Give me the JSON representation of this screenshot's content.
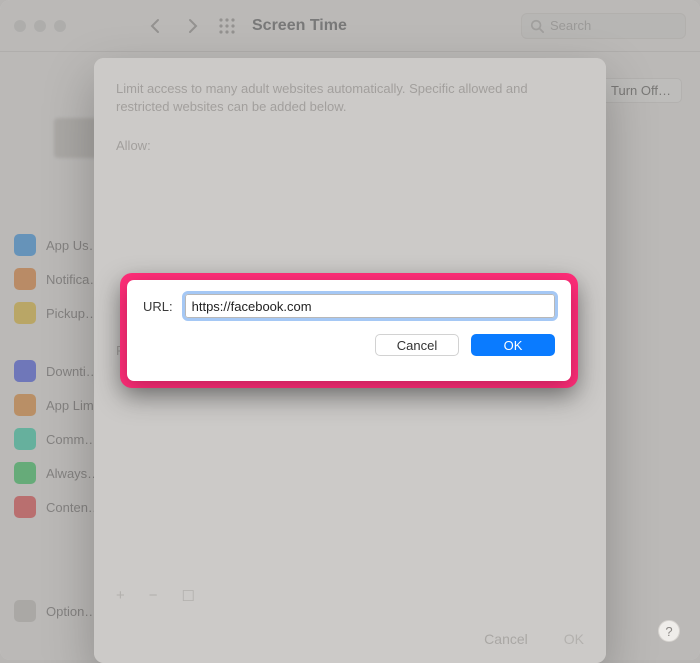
{
  "window": {
    "title": "Screen Time",
    "search_placeholder": "Search",
    "turn_off_label": "Turn Off…"
  },
  "sidebar": {
    "items": [
      {
        "label": "App Us…"
      },
      {
        "label": "Notifica…"
      },
      {
        "label": "Pickup…"
      },
      {
        "label": "Downti…"
      },
      {
        "label": "App Lim…"
      },
      {
        "label": "Comm…"
      },
      {
        "label": "Always…"
      },
      {
        "label": "Conten…"
      },
      {
        "label": "Option…"
      }
    ]
  },
  "content_sheet": {
    "description": "Limit access to many adult websites automatically. Specific allowed and restricted websites can be added below.",
    "allow_label": "Allow:",
    "restrict_initial": "R",
    "add_symbol": "+",
    "remove_symbol": "−",
    "edit_symbol": "☐",
    "cancel_label": "Cancel",
    "ok_label": "OK"
  },
  "url_sheet": {
    "url_label": "URL:",
    "url_value": "https://facebook.com",
    "cancel_label": "Cancel",
    "ok_label": "OK"
  },
  "help_label": "?"
}
